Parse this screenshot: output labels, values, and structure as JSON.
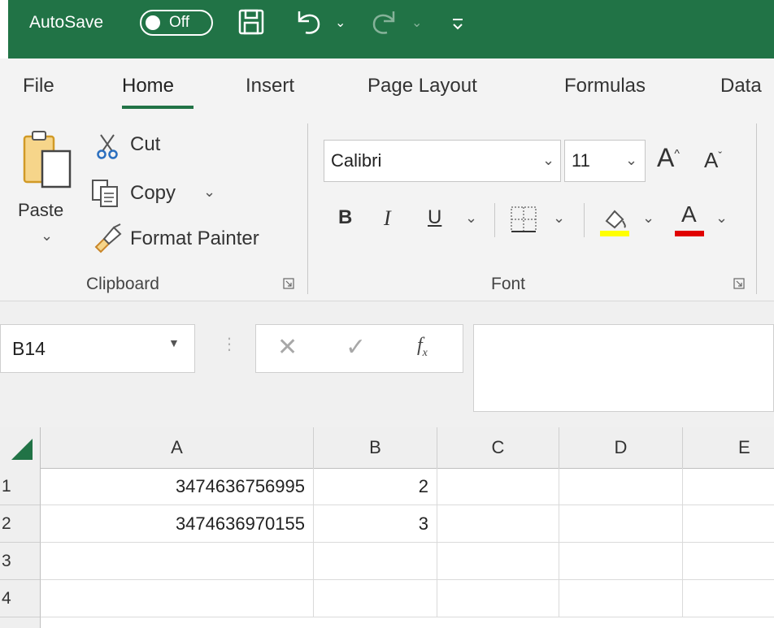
{
  "titlebar": {
    "autosave_label": "AutoSave",
    "autosave_state": "Off",
    "icons": [
      "save-icon",
      "undo-icon",
      "redo-icon",
      "customize-qat-icon"
    ]
  },
  "tabs": [
    {
      "label": "File"
    },
    {
      "label": "Home",
      "active": true
    },
    {
      "label": "Insert"
    },
    {
      "label": "Page Layout"
    },
    {
      "label": "Formulas"
    },
    {
      "label": "Data"
    }
  ],
  "ribbon": {
    "clipboard": {
      "paste_label": "Paste",
      "cut_label": "Cut",
      "copy_label": "Copy",
      "format_painter_label": "Format Painter",
      "group_label": "Clipboard"
    },
    "font": {
      "font_name": "Calibri",
      "font_size": "11",
      "bold_label": "B",
      "italic_label": "I",
      "underline_label": "U",
      "font_color_label": "A",
      "group_label": "Font",
      "highlight_color": "#ffff00",
      "font_color": "#e00000"
    }
  },
  "formula_bar": {
    "name_box": "B14",
    "formula_value": ""
  },
  "grid": {
    "columns": [
      "A",
      "B",
      "C",
      "D",
      "E"
    ],
    "rows": [
      {
        "num": "1",
        "cells": [
          "3474636756995",
          "2",
          "",
          "",
          ""
        ]
      },
      {
        "num": "2",
        "cells": [
          "3474636970155",
          "3",
          "",
          "",
          ""
        ]
      },
      {
        "num": "3",
        "cells": [
          "",
          "",
          "",
          "",
          ""
        ]
      },
      {
        "num": "4",
        "cells": [
          "",
          "",
          "",
          "",
          ""
        ]
      }
    ]
  },
  "colors": {
    "accent": "#217346"
  }
}
